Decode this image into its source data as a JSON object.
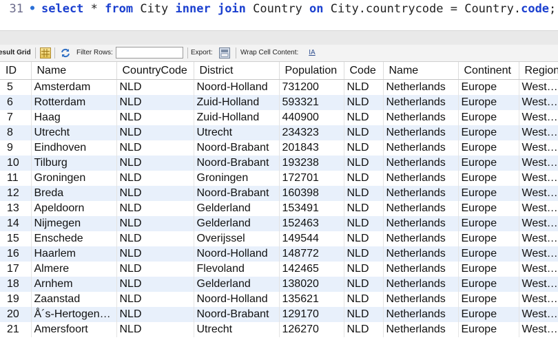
{
  "editor": {
    "line_number": "31",
    "tokens": [
      {
        "t": "select",
        "k": true
      },
      {
        "t": " * ",
        "k": false
      },
      {
        "t": "from",
        "k": true
      },
      {
        "t": " City ",
        "k": false
      },
      {
        "t": "inner",
        "k": true
      },
      {
        "t": " ",
        "k": false
      },
      {
        "t": "join",
        "k": true
      },
      {
        "t": " Country ",
        "k": false
      },
      {
        "t": "on",
        "k": true
      },
      {
        "t": " City.countrycode = Country.",
        "k": false
      },
      {
        "t": "code",
        "k": true
      },
      {
        "t": ";",
        "k": false
      }
    ]
  },
  "toolbar": {
    "result_grid": "esult Grid",
    "filter_rows": "Filter Rows:",
    "filter_value": "",
    "export": "Export:",
    "wrap_cell_content": "Wrap Cell Content:"
  },
  "grid": {
    "columns": [
      "ID",
      "Name",
      "CountryCode",
      "District",
      "Population",
      "Code",
      "Name",
      "Continent",
      "Region"
    ],
    "rows": [
      [
        "5",
        "Amsterdam",
        "NLD",
        "Noord-Holland",
        "731200",
        "NLD",
        "Netherlands",
        "Europe",
        "Western Europe"
      ],
      [
        "6",
        "Rotterdam",
        "NLD",
        "Zuid-Holland",
        "593321",
        "NLD",
        "Netherlands",
        "Europe",
        "Western Europe"
      ],
      [
        "7",
        "Haag",
        "NLD",
        "Zuid-Holland",
        "440900",
        "NLD",
        "Netherlands",
        "Europe",
        "Western Europe"
      ],
      [
        "8",
        "Utrecht",
        "NLD",
        "Utrecht",
        "234323",
        "NLD",
        "Netherlands",
        "Europe",
        "Western Europe"
      ],
      [
        "9",
        "Eindhoven",
        "NLD",
        "Noord-Brabant",
        "201843",
        "NLD",
        "Netherlands",
        "Europe",
        "Western Europe"
      ],
      [
        "10",
        "Tilburg",
        "NLD",
        "Noord-Brabant",
        "193238",
        "NLD",
        "Netherlands",
        "Europe",
        "Western Europe"
      ],
      [
        "11",
        "Groningen",
        "NLD",
        "Groningen",
        "172701",
        "NLD",
        "Netherlands",
        "Europe",
        "Western Europe"
      ],
      [
        "12",
        "Breda",
        "NLD",
        "Noord-Brabant",
        "160398",
        "NLD",
        "Netherlands",
        "Europe",
        "Western Europe"
      ],
      [
        "13",
        "Apeldoorn",
        "NLD",
        "Gelderland",
        "153491",
        "NLD",
        "Netherlands",
        "Europe",
        "Western Europe"
      ],
      [
        "14",
        "Nijmegen",
        "NLD",
        "Gelderland",
        "152463",
        "NLD",
        "Netherlands",
        "Europe",
        "Western Europe"
      ],
      [
        "15",
        "Enschede",
        "NLD",
        "Overijssel",
        "149544",
        "NLD",
        "Netherlands",
        "Europe",
        "Western Europe"
      ],
      [
        "16",
        "Haarlem",
        "NLD",
        "Noord-Holland",
        "148772",
        "NLD",
        "Netherlands",
        "Europe",
        "Western Europe"
      ],
      [
        "17",
        "Almere",
        "NLD",
        "Flevoland",
        "142465",
        "NLD",
        "Netherlands",
        "Europe",
        "Western Europe"
      ],
      [
        "18",
        "Arnhem",
        "NLD",
        "Gelderland",
        "138020",
        "NLD",
        "Netherlands",
        "Europe",
        "Western Europe"
      ],
      [
        "19",
        "Zaanstad",
        "NLD",
        "Noord-Holland",
        "135621",
        "NLD",
        "Netherlands",
        "Europe",
        "Western Europe"
      ],
      [
        "20",
        "Å´s-Hertogenbosch",
        "NLD",
        "Noord-Brabant",
        "129170",
        "NLD",
        "Netherlands",
        "Europe",
        "Western Europe"
      ],
      [
        "21",
        "Amersfoort",
        "NLD",
        "Utrecht",
        "126270",
        "NLD",
        "Netherlands",
        "Europe",
        "Western Europe"
      ]
    ]
  },
  "colors": {
    "keyword": "#1a3fcf",
    "row_alt": "#e8f0fb",
    "toolbar_bg": "#f3f3f3"
  },
  "icons": [
    "grid-icon",
    "refresh-icon",
    "export-icon",
    "wrap-text-icon"
  ]
}
